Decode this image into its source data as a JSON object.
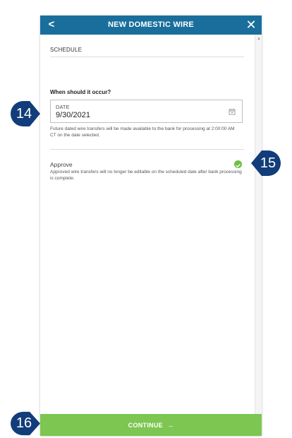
{
  "header": {
    "back_icon": "chevron-left-icon",
    "title": "NEW DOMESTIC WIRE",
    "close_icon": "close-icon",
    "color": "#1a6e9c"
  },
  "schedule": {
    "section_title": "SCHEDULE",
    "question": "When should it occur?",
    "date_field": {
      "label": "DATE",
      "value": "9/30/2021",
      "icon": "calendar-icon"
    },
    "date_helper": "Future dated wire transfers will be made available to the bank for processing at 2:00:00 AM CT on the date selected."
  },
  "approve": {
    "label": "Approve",
    "checked": true,
    "check_color": "#6cbf44",
    "description": "Approved wire transfers will no longer be editable on the scheduled date after bank processing is complete."
  },
  "footer": {
    "continue_label": "CONTINUE",
    "arrow": "→",
    "color": "#7cc651"
  },
  "callouts": {
    "date": "14",
    "approve": "15",
    "continue": "16",
    "color": "#123d7a"
  }
}
